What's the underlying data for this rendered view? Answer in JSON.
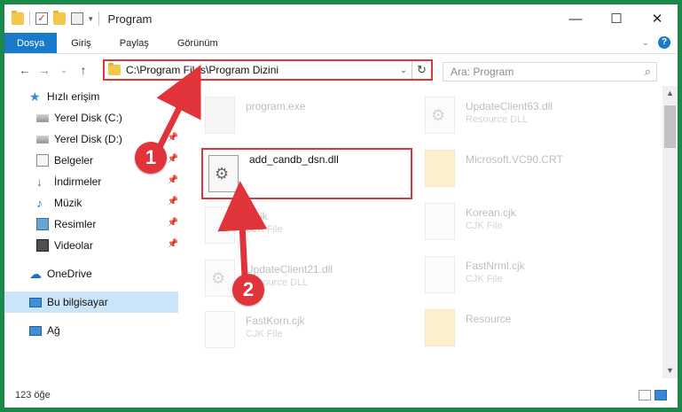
{
  "window": {
    "title": "Program"
  },
  "ribbon": {
    "tabs": [
      {
        "label": "Dosya",
        "active": true
      },
      {
        "label": "Giriş"
      },
      {
        "label": "Paylaş"
      },
      {
        "label": "Görünüm"
      }
    ]
  },
  "address": {
    "path": "C:\\Program Files\\Program Dizini",
    "search_placeholder": "Ara: Program"
  },
  "sidebar": {
    "quick_access": "Hızlı erişim",
    "items": [
      {
        "label": "Yerel Disk (C:)",
        "icon": "drive-icon"
      },
      {
        "label": "Yerel Disk (D:)",
        "icon": "drive-icon"
      },
      {
        "label": "Belgeler",
        "icon": "document-icon"
      },
      {
        "label": "İndirmeler",
        "icon": "download-icon"
      },
      {
        "label": "Müzik",
        "icon": "music-icon"
      },
      {
        "label": "Resimler",
        "icon": "pictures-icon"
      },
      {
        "label": "Videolar",
        "icon": "video-icon"
      }
    ],
    "onedrive": "OneDrive",
    "this_pc": "Bu bilgisayar",
    "network": "Ağ"
  },
  "files": {
    "left": [
      {
        "name": "program.exe",
        "type": ""
      },
      {
        "name": "add_candb_dsn.dll",
        "type": ""
      },
      {
        "name": "d.cjk",
        "type": "CJK File"
      },
      {
        "name": "UpdateClient21.dll",
        "type": "Resource DLL"
      },
      {
        "name": "FastKorn.cjk",
        "type": "CJK File"
      }
    ],
    "right": [
      {
        "name": "UpdateClient63.dll",
        "type": "Resource DLL"
      },
      {
        "name": "Microsoft.VC90.CRT",
        "type": ""
      },
      {
        "name": "Korean.cjk",
        "type": "CJK File"
      },
      {
        "name": "FastNrml.cjk",
        "type": "CJK File"
      },
      {
        "name": "Resource",
        "type": ""
      }
    ]
  },
  "status": {
    "count": "123 öğe"
  },
  "callouts": {
    "one": "1",
    "two": "2"
  },
  "colors": {
    "highlight": "#e0343a",
    "accent": "#1979ca",
    "desktop": "#1a8a4c"
  }
}
